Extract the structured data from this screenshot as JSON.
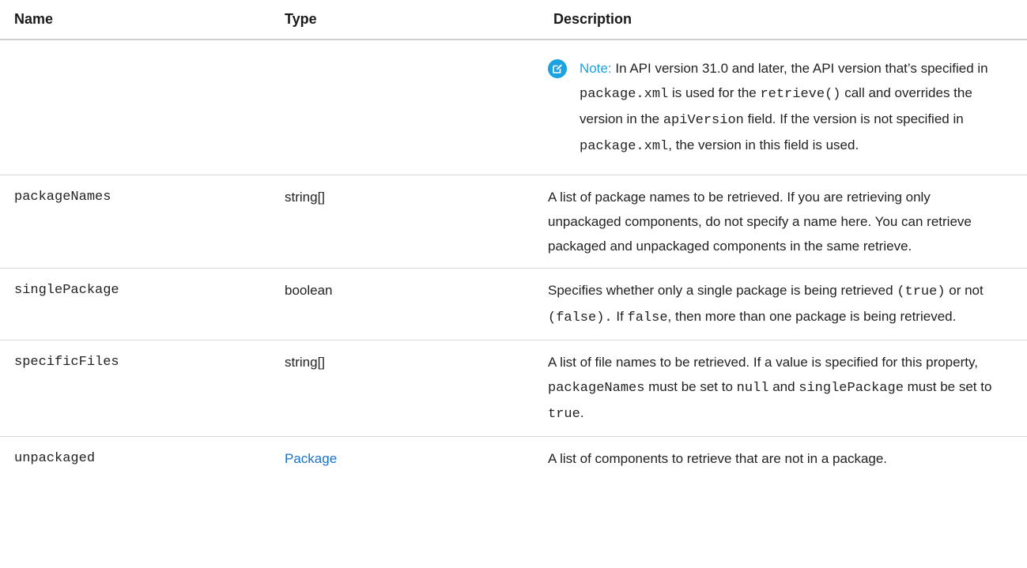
{
  "headers": {
    "name": "Name",
    "type": "Type",
    "description": "Description"
  },
  "note": {
    "label": "Note:",
    "t1": " In API version 31.0 and later, the API version that’s specified in ",
    "c1": "package.xml",
    "t2": " is used for the ",
    "c2": "retrieve()",
    "t3": " call and overrides the version in the ",
    "c3": "apiVersion",
    "t4": " field. If the version is not specified in ",
    "c4": "package.xml",
    "t5": ", the version in this field is used."
  },
  "rows": [
    {
      "name": "packageNames",
      "type": "string[]",
      "desc": {
        "t1": "A list of package names to be retrieved. If you are retrieving only unpackaged components, do not specify a name here. You can retrieve packaged and unpackaged components in the same retrieve."
      }
    },
    {
      "name": "singlePackage",
      "type": "boolean",
      "desc": {
        "t1": "Specifies whether only a single package is being retrieved ",
        "c1": "(true)",
        "t2": " or not ",
        "c2": "(false).",
        "t3": " If ",
        "c3": "false",
        "t4": ", then more than one package is being retrieved."
      }
    },
    {
      "name": "specificFiles",
      "type": "string[]",
      "desc": {
        "t1": "A list of file names to be retrieved. If a value is specified for this property, ",
        "c1": "packageNames",
        "t2": " must be set to ",
        "c2": "null",
        "t3": " and ",
        "c3": "singlePackage",
        "t4": " must be set to ",
        "c4": "true",
        "t5": "."
      }
    },
    {
      "name": "unpackaged",
      "type": "Package",
      "desc": {
        "t1": "A list of components to retrieve that are not in a package."
      }
    }
  ],
  "colors": {
    "link": "#1a72c7",
    "note_accent": "#1aa3e0",
    "rule": "#d8d8d8"
  },
  "icons": {
    "note": "edit-note-icon"
  }
}
